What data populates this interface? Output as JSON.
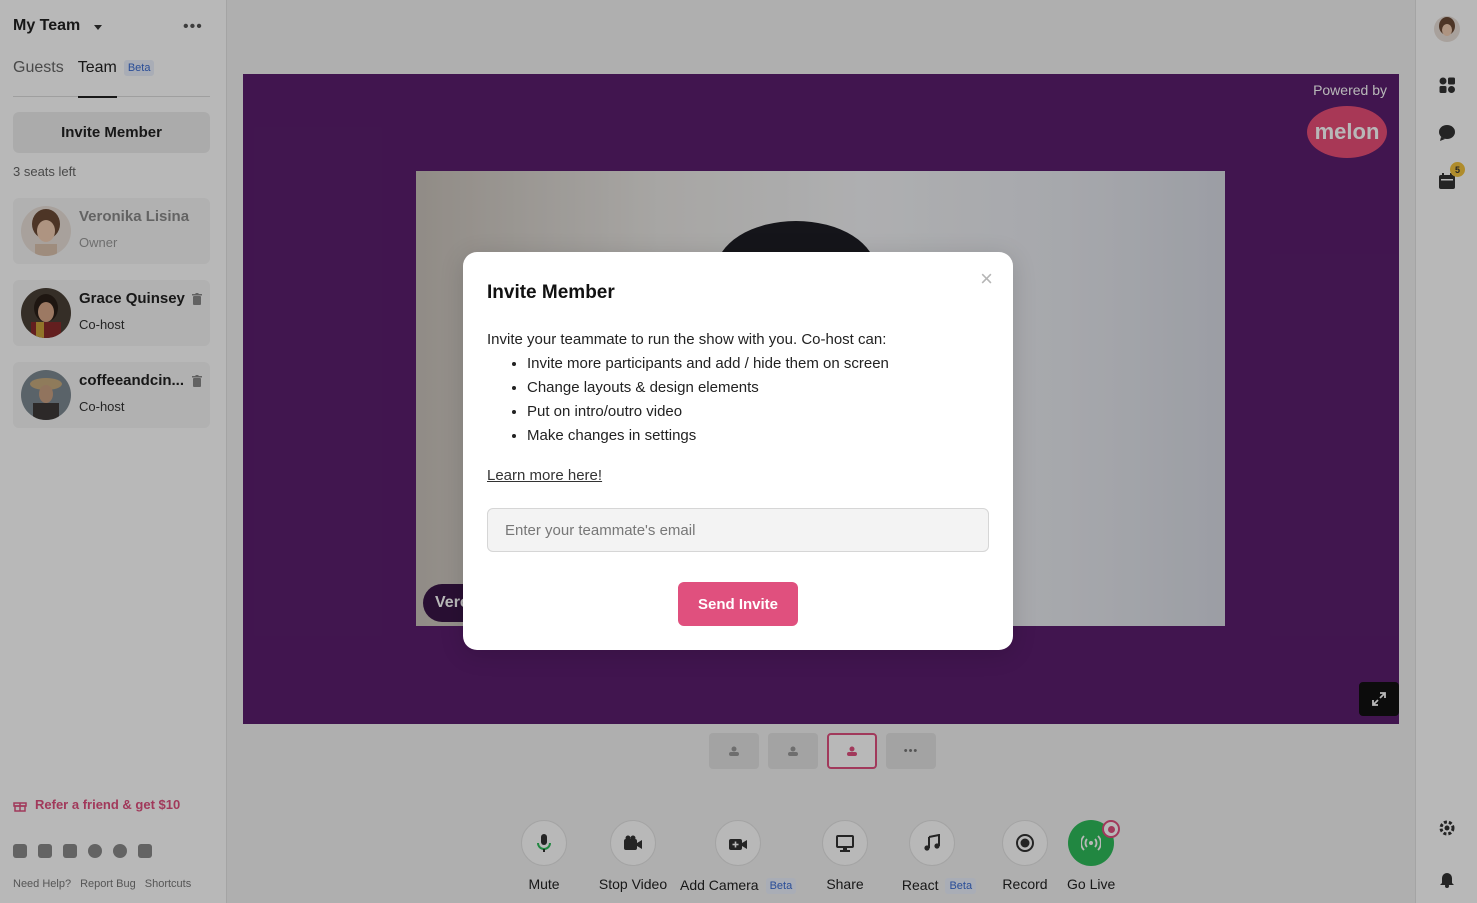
{
  "sidebar": {
    "team_title": "My Team",
    "tabs": [
      {
        "label": "Guests"
      },
      {
        "label": "Team",
        "badge": "Beta"
      }
    ],
    "invite_button": "Invite Member",
    "seats_left": "3 seats left",
    "members": [
      {
        "name": "Veronika Lisina",
        "role": "Owner"
      },
      {
        "name": "Grace Quinsey",
        "role": "Co-host"
      },
      {
        "name": "coffeeandcin...",
        "role": "Co-host"
      }
    ],
    "refer": "Refer a friend & get $10",
    "footer": {
      "help": "Need Help?",
      "bug": "Report Bug",
      "shortcuts": "Shortcuts"
    }
  },
  "stage": {
    "powered_by": "Powered by",
    "brand": "melon",
    "name_tag": "Veronika Lisina",
    "accent": "#e0507e",
    "background": "#5a1e6e"
  },
  "toolbar": {
    "mute": "Mute",
    "stop_video": "Stop Video",
    "add_camera": "Add Camera",
    "add_camera_badge": "Beta",
    "share": "Share",
    "react": "React",
    "react_badge": "Beta",
    "record": "Record",
    "go_live": "Go Live"
  },
  "right_rail": {
    "calendar_badge": "5"
  },
  "modal": {
    "title": "Invite Member",
    "intro": "Invite your teammate to run the show with you. Co-host can:",
    "bullets": [
      "Invite more participants and add / hide them on screen",
      "Change layouts & design elements",
      "Put on intro/outro video",
      "Make changes in settings"
    ],
    "learn_more": "Learn more here!",
    "email_placeholder": "Enter your teammate's email",
    "send_button": "Send Invite"
  }
}
